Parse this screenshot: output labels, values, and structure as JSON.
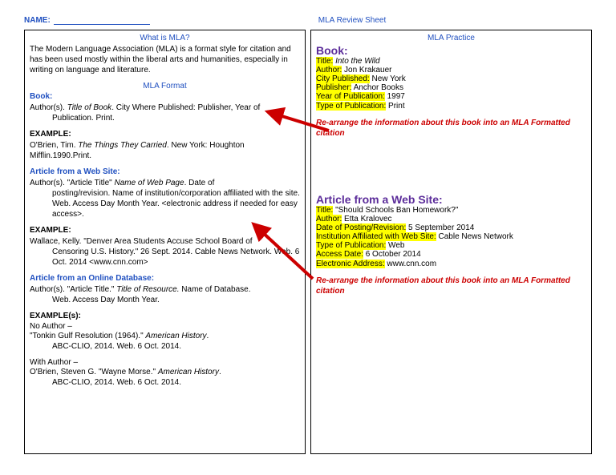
{
  "header": {
    "nameLabel": "NAME:",
    "title": "MLA Review Sheet"
  },
  "left": {
    "qHead": "What is MLA?",
    "intro": "The Modern Language Association (MLA) is a format style for citation and has been used mostly within the liberal arts and humanities, especially in writing on language and literature.",
    "formatHead": "MLA Format",
    "book": {
      "head": "Book:",
      "pattern1": "Author(s). ",
      "patternItalic": "Title of Book",
      "pattern2": ". City Where Published: Publisher, Year of",
      "pattern3": "Publication. Print.",
      "exHead": "EXAMPLE:",
      "ex1": "O'Brien, Tim. ",
      "exItalic": "The Things They Carried",
      "ex2": ". New York: Houghton",
      "ex3": "Mifflin.1990.Print."
    },
    "web": {
      "head": "Article from a Web Site:",
      "p1": "Author(s). \"Article Title\" ",
      "pItalic": "Name of Web Page",
      "p2": ". Date of",
      "p3": "posting/revision. Name of institution/corporation affiliated with the site. Web. Access Day Month Year. <electronic address if needed for easy access>.",
      "exHead": "EXAMPLE:",
      "ex1": "Wallace, Kelly. \"Denver Area Students Accuse School Board of",
      "ex2": "Censoring U.S. History.\" 26 Sept. 2014. Cable News Network. Web. 6 Oct. 2014 <www.cnn.com>"
    },
    "db": {
      "head": "Article from an Online Database:",
      "p1": "Author(s). \"Article Title.\" ",
      "pItalic": "Title of Resource.",
      "p2": " Name of Database.",
      "p3": "Web. Access Day Month Year.",
      "exHead": "EXAMPLE(s):",
      "noAuth": "No Author –",
      "na1": "\"Tonkin Gulf Resolution (1964).\" ",
      "naItalic": "American History",
      "na2": ".",
      "na3": "ABC-CLIO, 2014. Web. 6 Oct. 2014.",
      "withAuth": "With Author –",
      "wa1": "O'Brien, Steven G. \"Wayne Morse.\" ",
      "waItalic": "American History",
      "wa2": ".",
      "wa3": "ABC-CLIO, 2014. Web. 6 Oct. 2014."
    }
  },
  "right": {
    "head": "MLA Practice",
    "book": {
      "head": "Book:",
      "titleLbl": "Title:",
      "title": "Into the Wild",
      "authorLbl": "Author:",
      "author": " Jon Krakauer",
      "cityLbl": "City Published:",
      "city": " New York",
      "pubLbl": "Publisher:",
      "pub": " Anchor Books",
      "yearLbl": "Year of Publication:",
      "year": " 1997",
      "typeLbl": "Type of Publication:",
      "type": " Print"
    },
    "instr": "Re-arrange the information about this book into an MLA Formatted citation",
    "web": {
      "head": "Article from a Web Site:",
      "titleLbl": "Title:",
      "title": " \"Should Schools Ban Homework?\"",
      "authorLbl": "Author:",
      "author": " Etta Kralovec",
      "dateLbl": "Date of Posting/Revision:",
      "date": " 5 September 2014",
      "instLbl": "Institution Affiliated with Web Site:",
      "inst": " Cable News Network",
      "typeLbl": "Type of Publication:",
      "type": " Web",
      "accessLbl": "Access Date:",
      "access": " 6 October 2014",
      "addrLbl": "Electronic Address:",
      "addr": " www.cnn.com"
    }
  }
}
